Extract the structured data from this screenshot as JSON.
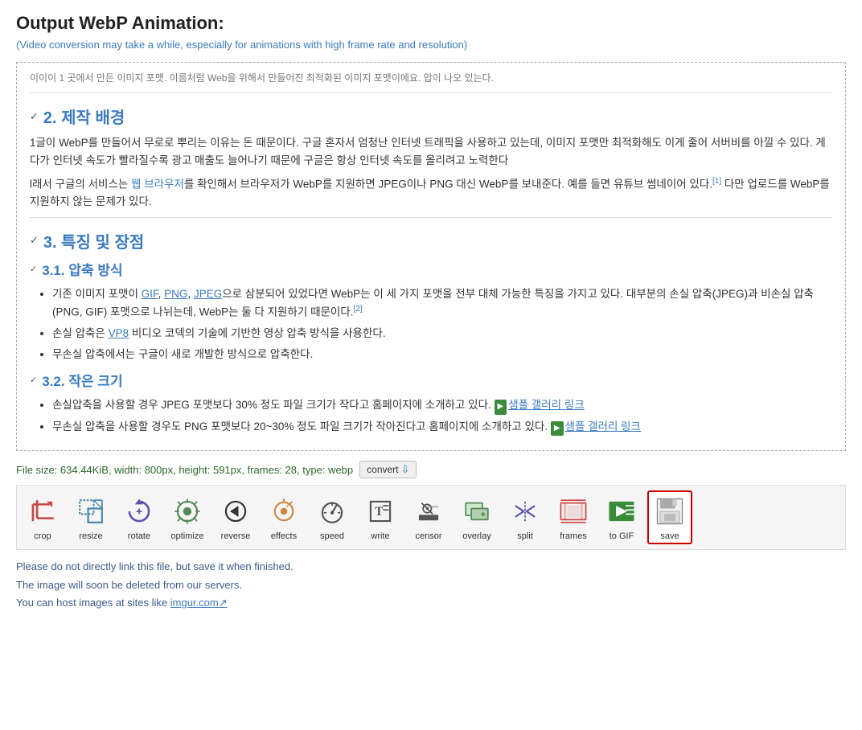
{
  "page": {
    "title": "Output WebP Animation:",
    "subtitle": "(Video conversion may take a while, especially for animations with high frame rate and resolution)"
  },
  "content": {
    "faded_text": "이이이 1 곳에서 만든 이미지 포맷. 이름처럼 Web을 위해서 만들어진 최적화된 이미지 포맷이에요. 압이 나오 있는다.",
    "section2": {
      "number": "2.",
      "title": "제작 배경",
      "body1": "1글이 WebP를 만들어서 무로로 뿌리는 이유는 돈 때문이다. 구글 혼자서 엄청난 인터넷 트래픽을 사용하고 있는데, 이미지 포맷만 최적화해도 이게 줄어 서버비를 아낄 수 있다. 게다가 인터넷 속도가 빨라질수록 광고 매출도 늘어나기 때문에 구글은 항상 인터넷 속도를 올리려고 노력한다",
      "body2_prefix": "l래서 구글의 서비스는 ",
      "body2_link": "웹 브라우저",
      "body2_suffix": "를 확인해서 브라우저가 WebP를 지원하면 JPEG이나 PNG 대신 WebP를 보내준다. 예를 들면 유튜브 썸네이어 있다.",
      "body2_sup": "[1]",
      "body2_end": " 다만 업로드를 WebP를 지원하지 않는 문제가 있다."
    },
    "section3": {
      "number": "3.",
      "title": "특징 및 장점"
    },
    "section31": {
      "number": "3.1.",
      "title": "압축 방식",
      "bullets": [
        "기존 이미지 포맷이 GIF, PNG, JPEG으로 삼분되어 있었다면 WebP는 이 세 가지 포맷을 전부 대체 가능한 특징을 가지고 있다. 대부분의 손실 압축(JPEG)과 비손실 압축(PNG, GIF) 포맷으로 나뉘는데, WebP는 둘 다 지원하기 때문이다.[2]",
        "손실 압축은 VP8 비디오 코덱의 기술에 기반한 영상 압축 방식을 사용한다.",
        "무손실 압축에서는 구글이 새로 개발한 방식으로 압축한다."
      ]
    },
    "section32": {
      "number": "3.2.",
      "title": "작은 크기",
      "bullets": [
        "손실압축을 사용할 경우 JPEG 포맷보다 30% 정도 파일 크기가 작다고 홈페이지에 소개하고 있다. 샘플 갤러리 링크",
        "무손실 압축을 사용할 경우도 PNG 포맷보다 20~30% 정도 파일 크기가 작아진다고 홈페이지에 소개하고 있다. 샘플 갤러리 링크"
      ]
    }
  },
  "file_info": {
    "label": "File size: 634.44KiB, width: 800px, height: 591px, frames: 28, type: webp",
    "convert_label": "convert"
  },
  "toolbar": {
    "tools": [
      {
        "id": "crop",
        "label": "crop",
        "icon": "crop"
      },
      {
        "id": "resize",
        "label": "resize",
        "icon": "resize"
      },
      {
        "id": "rotate",
        "label": "rotate",
        "icon": "rotate"
      },
      {
        "id": "optimize",
        "label": "optimize",
        "icon": "optimize"
      },
      {
        "id": "reverse",
        "label": "reverse",
        "icon": "reverse"
      },
      {
        "id": "effects",
        "label": "effects",
        "icon": "effects"
      },
      {
        "id": "speed",
        "label": "speed",
        "icon": "speed"
      },
      {
        "id": "write",
        "label": "write",
        "icon": "write"
      },
      {
        "id": "censor",
        "label": "censor",
        "icon": "censor"
      },
      {
        "id": "overlay",
        "label": "overlay",
        "icon": "overlay"
      },
      {
        "id": "split",
        "label": "split",
        "icon": "split"
      },
      {
        "id": "frames",
        "label": "frames",
        "icon": "frames"
      },
      {
        "id": "to-gif",
        "label": "to GIF",
        "icon": "togif",
        "highlighted": false
      },
      {
        "id": "save",
        "label": "save",
        "icon": "save",
        "highlighted": true
      }
    ]
  },
  "notice": {
    "line1": "Please do not directly link this file, but save it when finished.",
    "line2": "The image will soon be deleted from our servers.",
    "line3_prefix": "You can host images at sites like ",
    "line3_link": "imgur.com",
    "line3_suffix": ""
  }
}
